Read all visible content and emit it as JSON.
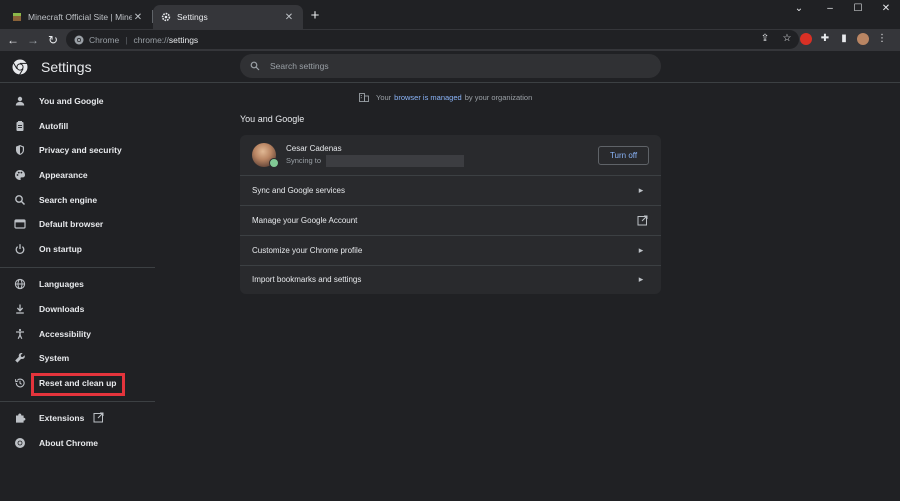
{
  "browser": {
    "tabs": [
      {
        "title": "Minecraft Official Site | Minecraft",
        "active": false,
        "favicon": "minecraft-icon"
      },
      {
        "title": "Settings",
        "active": true,
        "favicon": "gear-icon"
      }
    ],
    "new_tab_label": "+",
    "omnibox": {
      "chip": "Chrome",
      "separator": "|",
      "scheme": "chrome://",
      "path": "settings"
    }
  },
  "settings": {
    "title": "Settings",
    "search_placeholder": "Search settings"
  },
  "sidebar": {
    "items": [
      {
        "label": "You and Google",
        "icon": "person-icon"
      },
      {
        "label": "Autofill",
        "icon": "clipboard-icon"
      },
      {
        "label": "Privacy and security",
        "icon": "shield-icon"
      },
      {
        "label": "Appearance",
        "icon": "palette-icon"
      },
      {
        "label": "Search engine",
        "icon": "search-icon"
      },
      {
        "label": "Default browser",
        "icon": "browser-icon"
      },
      {
        "label": "On startup",
        "icon": "power-icon"
      },
      {
        "label": "Languages",
        "icon": "globe-icon"
      },
      {
        "label": "Downloads",
        "icon": "download-icon"
      },
      {
        "label": "Accessibility",
        "icon": "accessibility-icon"
      },
      {
        "label": "System",
        "icon": "wrench-icon"
      },
      {
        "label": "Reset and clean up",
        "icon": "history-icon"
      },
      {
        "label": "Extensions",
        "icon": "puzzle-icon"
      },
      {
        "label": "About Chrome",
        "icon": "chrome-icon"
      }
    ],
    "highlight_color": "#e4343c"
  },
  "main": {
    "managed": {
      "prefix": "Your",
      "link": "browser is managed",
      "suffix": "by your organization"
    },
    "section_title": "You and Google",
    "profile": {
      "name": "Cesar Cadenas",
      "sync_text": "Syncing to",
      "button": "Turn off"
    },
    "rows": [
      {
        "label": "Sync and Google services",
        "icon": "chevron-right-icon"
      },
      {
        "label": "Manage your Google Account",
        "icon": "external-link-icon"
      },
      {
        "label": "Customize your Chrome profile",
        "icon": "chevron-right-icon"
      },
      {
        "label": "Import bookmarks and settings",
        "icon": "chevron-right-icon"
      }
    ]
  },
  "colors": {
    "background": "#202124",
    "card": "#292a2d",
    "accent": "#8ab4f8"
  }
}
